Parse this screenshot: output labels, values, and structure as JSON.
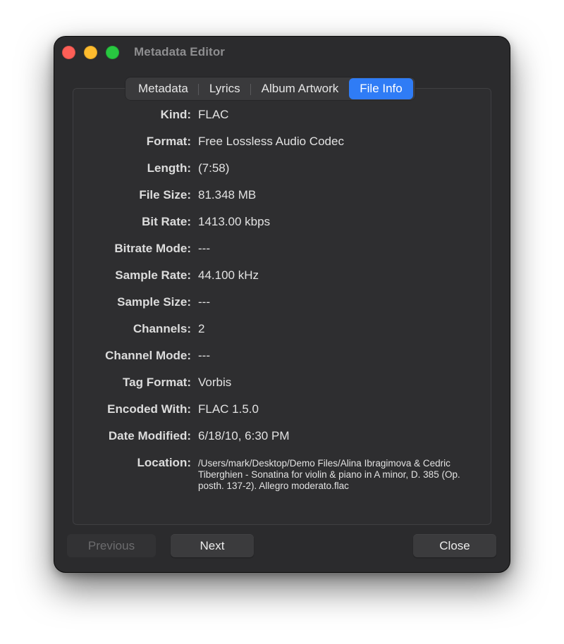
{
  "window": {
    "title": "Metadata Editor"
  },
  "tabs": [
    {
      "label": "Metadata",
      "active": false
    },
    {
      "label": "Lyrics",
      "active": false
    },
    {
      "label": "Album Artwork",
      "active": false
    },
    {
      "label": "File Info",
      "active": true
    }
  ],
  "file_info": [
    {
      "label": "Kind:",
      "value": "FLAC"
    },
    {
      "label": "Format:",
      "value": "Free Lossless Audio Codec"
    },
    {
      "label": "Length:",
      "value": "(7:58)"
    },
    {
      "label": "File Size:",
      "value": "81.348 MB"
    },
    {
      "label": "Bit Rate:",
      "value": "1413.00 kbps"
    },
    {
      "label": "Bitrate Mode:",
      "value": "---"
    },
    {
      "label": "Sample Rate:",
      "value": "44.100 kHz"
    },
    {
      "label": "Sample Size:",
      "value": "---"
    },
    {
      "label": "Channels:",
      "value": "2"
    },
    {
      "label": "Channel Mode:",
      "value": "---"
    },
    {
      "label": "Tag Format:",
      "value": "Vorbis"
    },
    {
      "label": "Encoded With:",
      "value": "FLAC 1.5.0"
    },
    {
      "label": "Date Modified:",
      "value": "6/18/10, 6:30 PM"
    },
    {
      "label": "Location:",
      "value": "/Users/mark/Desktop/Demo Files/Alina Ibragimova & Cedric Tiberghien - Sonatina for violin & piano in A minor, D. 385 (Op. posth. 137-2). Allegro moderato.flac"
    }
  ],
  "buttons": {
    "previous": "Previous",
    "next": "Next",
    "close": "Close"
  },
  "colors": {
    "accent": "#2f7cf6",
    "window_bg": "#2b2b2d",
    "traffic_close": "#fe5f57",
    "traffic_minimize": "#febc2e",
    "traffic_zoom": "#28c840"
  }
}
